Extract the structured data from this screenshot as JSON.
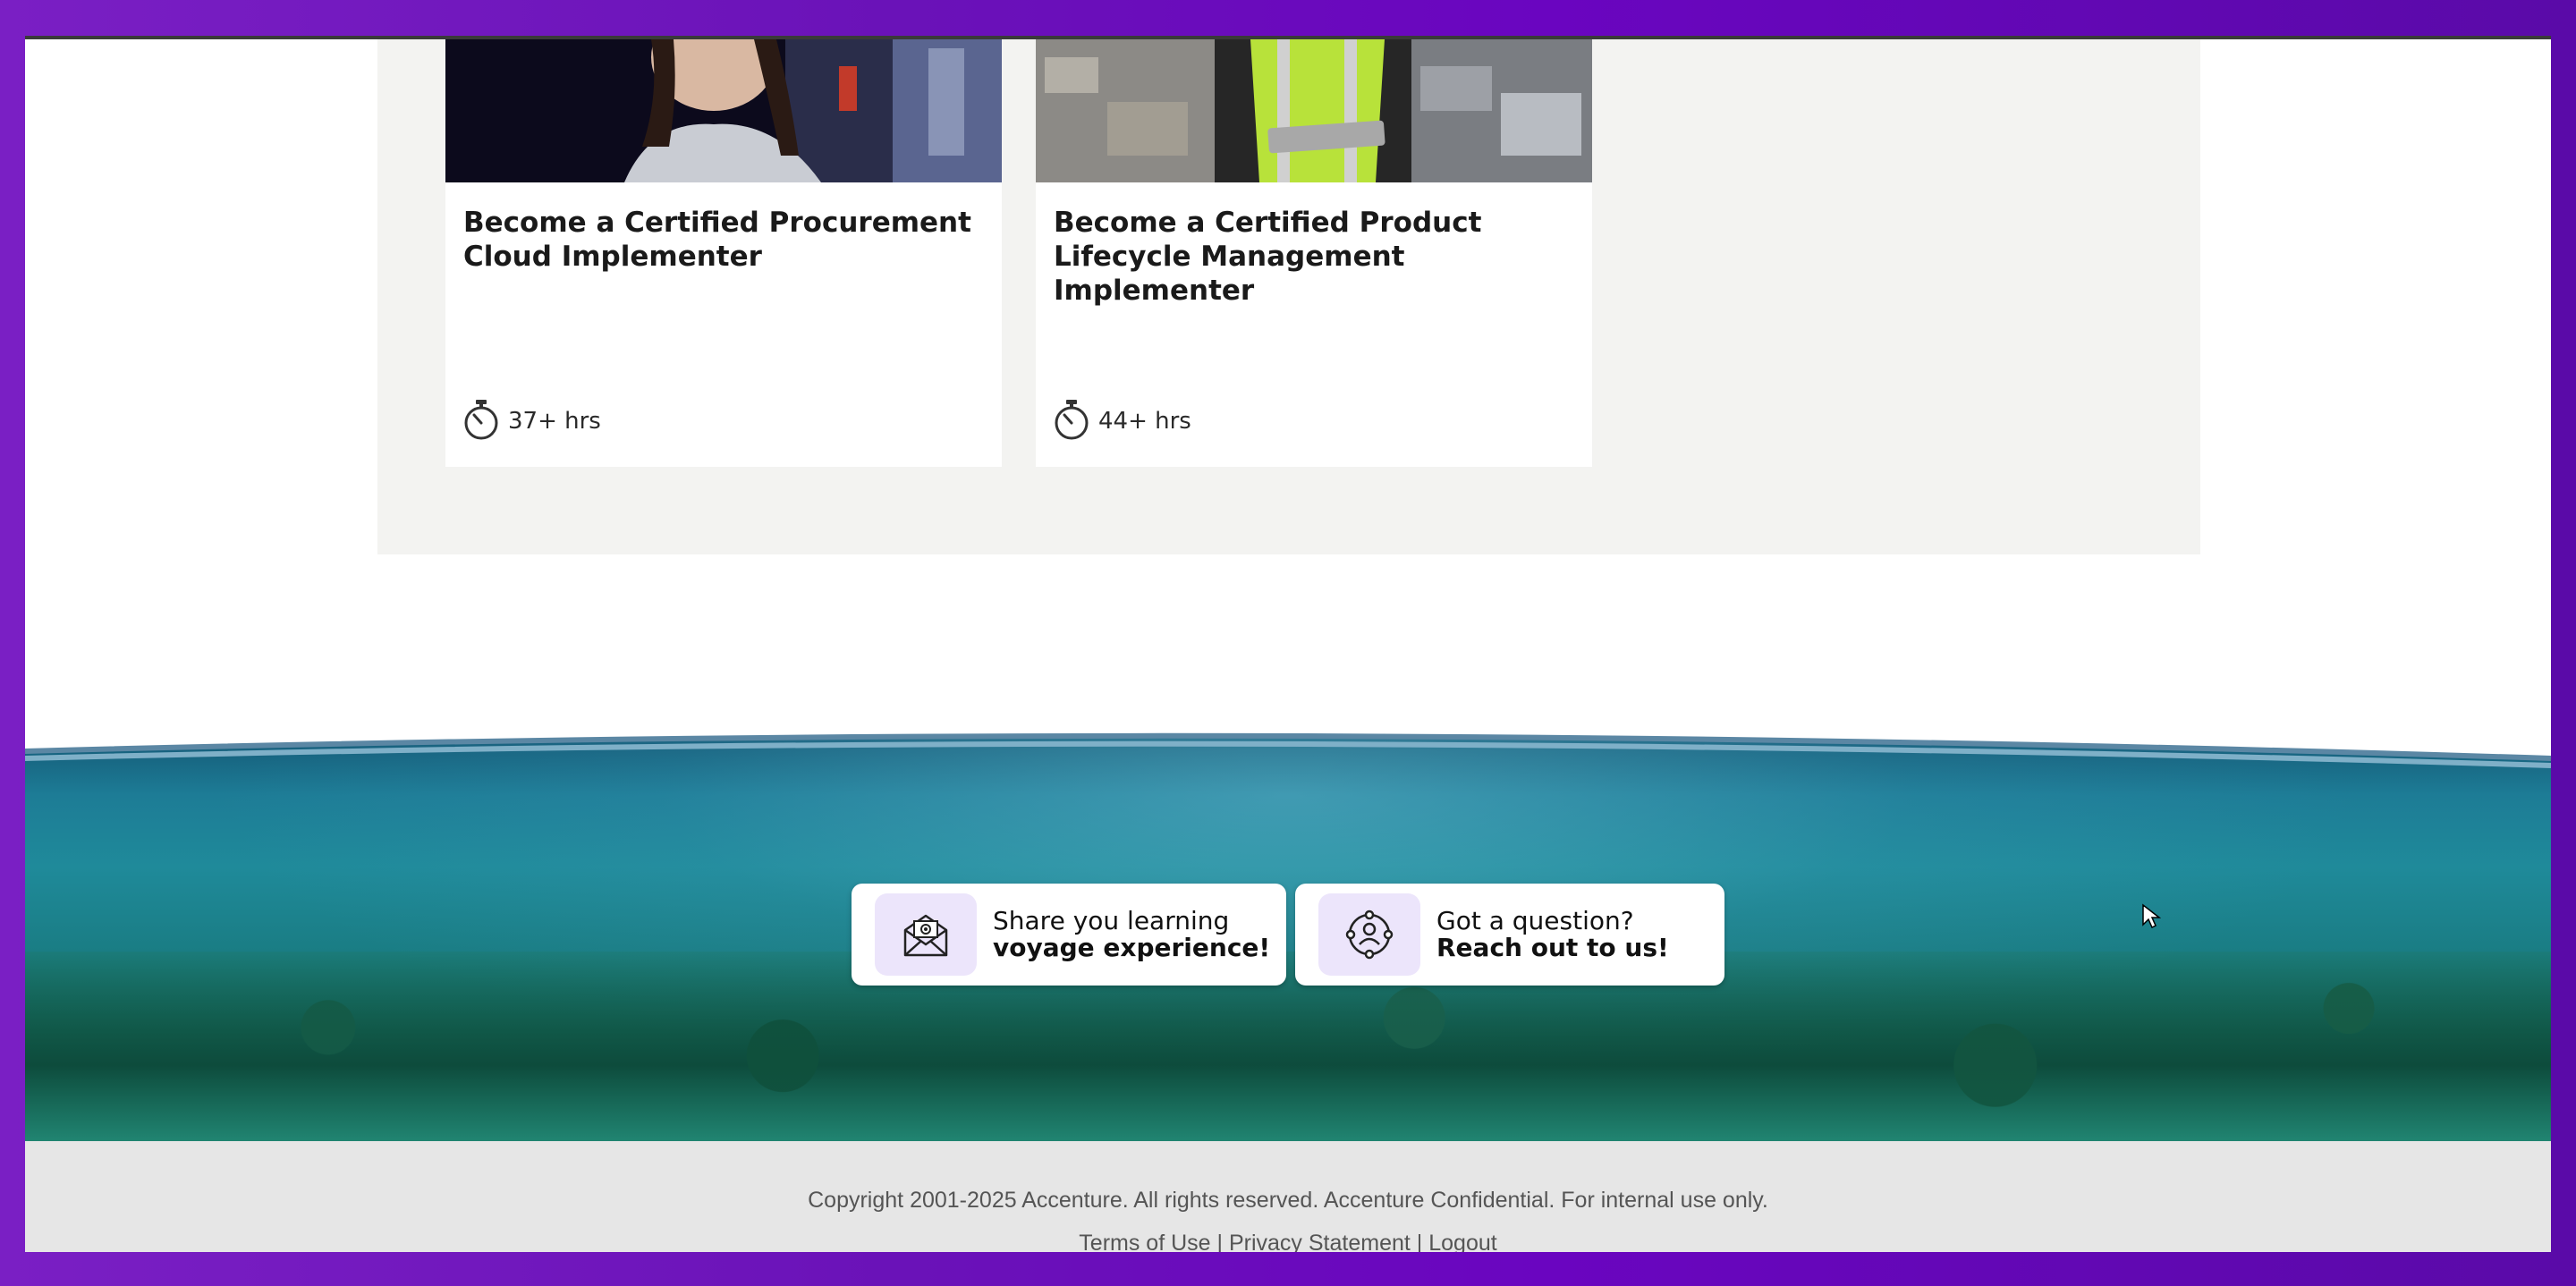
{
  "cards": [
    {
      "title": "Become a Certified Procurement Cloud Implementer",
      "duration": "37+ hrs"
    },
    {
      "title": "Become a Certified Product Lifecycle Management Implementer",
      "duration": "44+ hrs"
    }
  ],
  "footer_cards": [
    {
      "line1": "Share you learning",
      "line2": "voyage experience!",
      "icon": "envelope-icon"
    },
    {
      "line1": "Got a question?",
      "line2": "Reach out to us!",
      "icon": "support-agent-icon"
    }
  ],
  "footer": {
    "copyright": "Copyright 2001-2025 Accenture. All rights reserved. Accenture Confidential. For internal use only.",
    "links": [
      "Terms of Use",
      "Privacy Statement",
      "Logout"
    ],
    "separator": "|"
  },
  "colors": {
    "accent": "#6a05c0",
    "icon_bg": "#ece5fb"
  }
}
